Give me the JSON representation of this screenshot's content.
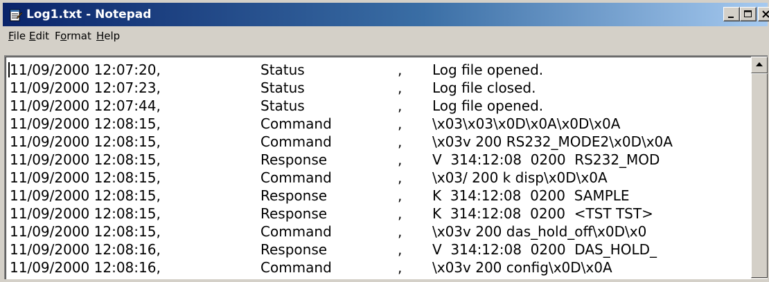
{
  "window": {
    "title": "Log1.txt - Notepad",
    "app_icon": "notepad-icon",
    "controls": [
      "minimize-icon",
      "maximize-icon",
      "close-icon"
    ]
  },
  "menubar": {
    "items": [
      {
        "label": "File",
        "mnemonic": "F"
      },
      {
        "label": "Edit",
        "mnemonic": "E"
      },
      {
        "label": "Format",
        "mnemonic": "o"
      },
      {
        "label": "Help",
        "mnemonic": "H"
      }
    ]
  },
  "log": {
    "lines": [
      {
        "timestamp": "11/09/2000 12:07:20,",
        "type": "Status",
        "sep": ",",
        "message": "Log file opened."
      },
      {
        "timestamp": "11/09/2000 12:07:23,",
        "type": "Status",
        "sep": ",",
        "message": "Log file closed."
      },
      {
        "timestamp": "11/09/2000 12:07:44,",
        "type": "Status",
        "sep": ",",
        "message": "Log file opened."
      },
      {
        "timestamp": "11/09/2000 12:08:15,",
        "type": "Command",
        "sep": ",",
        "message": "\\x03\\x03\\x0D\\x0A\\x0D\\x0A"
      },
      {
        "timestamp": "11/09/2000 12:08:15,",
        "type": "Command",
        "sep": ",",
        "message": "\\x03v 200 RS232_MODE2\\x0D\\x0A"
      },
      {
        "timestamp": "11/09/2000 12:08:15,",
        "type": "Response",
        "sep": ",",
        "message": "V  314:12:08  0200  RS232_MOD"
      },
      {
        "timestamp": "11/09/2000 12:08:15,",
        "type": "Command",
        "sep": ",",
        "message": "\\x03/ 200 k disp\\x0D\\x0A"
      },
      {
        "timestamp": "11/09/2000 12:08:15,",
        "type": "Response",
        "sep": ",",
        "message": "K  314:12:08  0200  SAMPLE"
      },
      {
        "timestamp": "11/09/2000 12:08:15,",
        "type": "Response",
        "sep": ",",
        "message": "K  314:12:08  0200  <TST TST>"
      },
      {
        "timestamp": "11/09/2000 12:08:15,",
        "type": "Command",
        "sep": ",",
        "message": "\\x03v 200 das_hold_off\\x0D\\x0"
      },
      {
        "timestamp": "11/09/2000 12:08:16,",
        "type": "Response",
        "sep": ",",
        "message": "V  314:12:08  0200  DAS_HOLD_"
      },
      {
        "timestamp": "11/09/2000 12:08:16,",
        "type": "Command",
        "sep": ",",
        "message": "\\x03v 200 config\\x0D\\x0A"
      }
    ]
  },
  "colors": {
    "titlebar_start": "#0a246a",
    "titlebar_end": "#a6caf0",
    "chrome": "#d4d0c8",
    "text_background": "#ffffff"
  }
}
